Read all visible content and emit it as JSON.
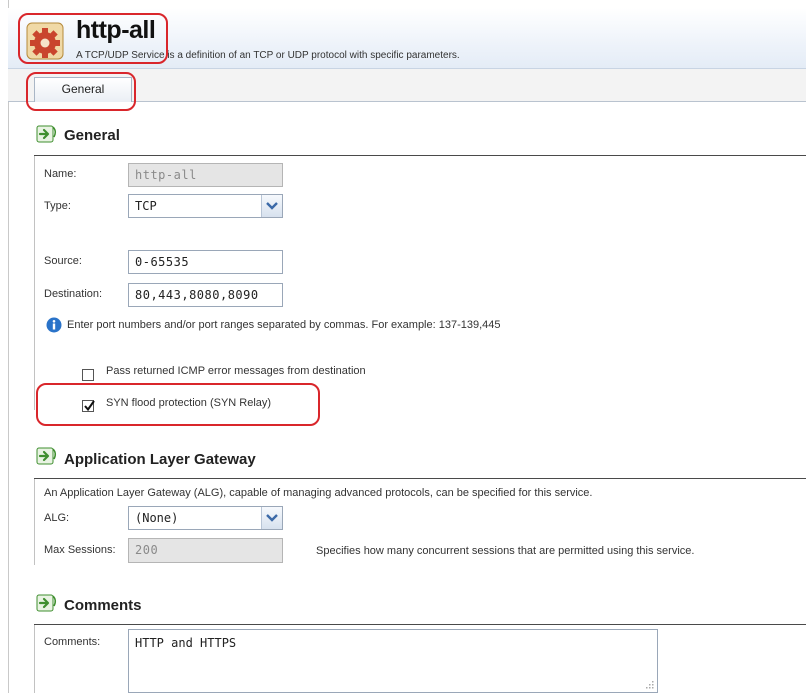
{
  "header": {
    "title": "http-all",
    "description": "A TCP/UDP Service is a definition of an TCP or UDP protocol with specific parameters."
  },
  "tabs": [
    {
      "label": "General"
    }
  ],
  "general": {
    "section_title": "General",
    "name_label": "Name:",
    "name_value": "http-all",
    "type_label": "Type:",
    "type_value": "TCP",
    "source_label": "Source:",
    "source_value": "0-65535",
    "destination_label": "Destination:",
    "destination_value": "80,443,8080,8090",
    "info_text": "Enter port numbers and/or port ranges separated by commas. For example: 137-139,445",
    "icmp_label": "Pass returned ICMP error messages from destination",
    "icmp_checked": false,
    "syn_label": "SYN flood protection (SYN Relay)",
    "syn_checked": true
  },
  "alg": {
    "section_title": "Application Layer Gateway",
    "description": "An Application Layer Gateway (ALG), capable of managing advanced protocols, can be specified for this service.",
    "alg_label": "ALG:",
    "alg_value": "(None)",
    "max_sessions_label": "Max Sessions:",
    "max_sessions_value": "200",
    "max_sessions_help": "Specifies how many concurrent sessions that are permitted using this service."
  },
  "comments": {
    "section_title": "Comments",
    "comments_label": "Comments:",
    "comments_value": "HTTP and HTTPS"
  },
  "colors": {
    "highlight": "#d9262b",
    "header_bg": "#e4ecf6",
    "info_icon": "#2a73c9",
    "section_icon": "#3f8f2f"
  },
  "icons": [
    "service-gear-icon",
    "section-arrow-icon",
    "info-icon",
    "chevron-down-icon",
    "checkmark-icon"
  ]
}
